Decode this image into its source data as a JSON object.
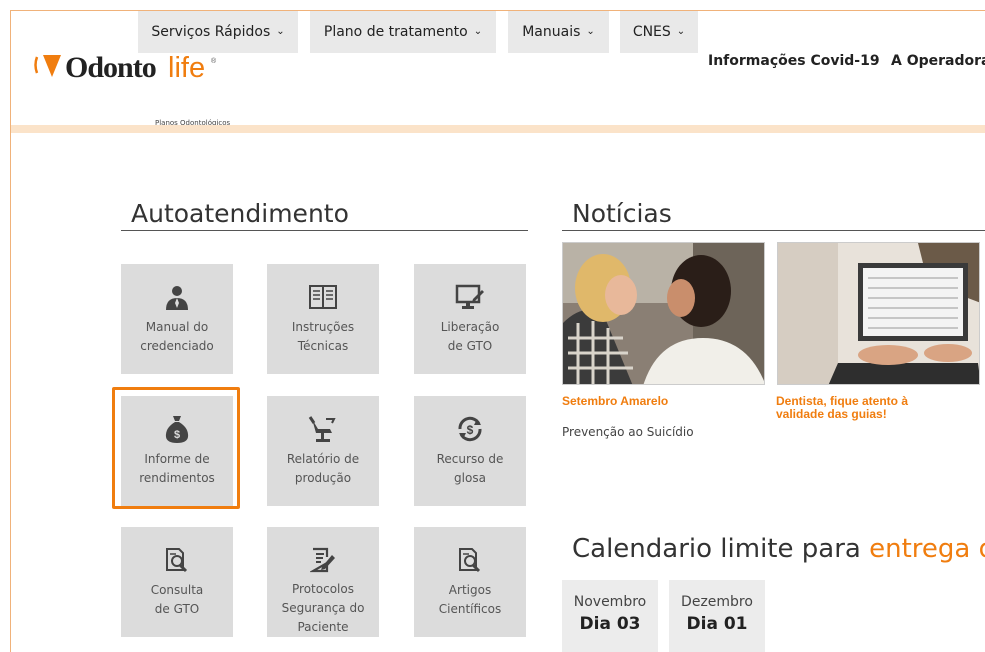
{
  "header": {
    "logo_text_1": "Odonto",
    "logo_text_2": "life",
    "logo_sub": "Planos Odontológicos",
    "nav": [
      "Informações Covid-19",
      "A Operadora"
    ]
  },
  "menu": {
    "items": [
      "Serviços Rápidos",
      "Plano de tratamento",
      "Manuais",
      "CNES"
    ],
    "chevron": "⌄"
  },
  "autoatendimento": {
    "title": "Autoatendimento",
    "tiles": [
      {
        "label": "Manual do credenciado",
        "icon": "person-tie-icon"
      },
      {
        "label": "Instruções Técnicas",
        "icon": "book-icon"
      },
      {
        "label": "Liberação de GTO",
        "icon": "monitor-pen-icon"
      },
      {
        "label": "Informe de rendimentos",
        "icon": "money-bag-icon"
      },
      {
        "label": "Relatório de produção",
        "icon": "dental-chair-icon"
      },
      {
        "label": "Recurso de glosa",
        "icon": "money-refresh-icon"
      },
      {
        "label": "Consulta de GTO",
        "icon": "document-search-icon"
      },
      {
        "label": "Protocolos Segurança do Paciente",
        "icon": "document-edit-icon"
      },
      {
        "label": "Artigos Científicos",
        "icon": "document-search-icon"
      }
    ]
  },
  "noticias": {
    "title": "Notícias",
    "items": [
      {
        "title": "Setembro Amarelo",
        "subtitle": "Prevenção ao Suicídio"
      },
      {
        "title": "Dentista, fique atento à validade das guias!",
        "subtitle": ""
      }
    ]
  },
  "calendario": {
    "title_plain": "Calendario limite para",
    "title_accent": "entrega d",
    "cards": [
      {
        "month": "Novembro",
        "day": "Dia 03"
      },
      {
        "month": "Dezembro",
        "day": "Dia 01"
      }
    ]
  },
  "colors": {
    "accent": "#f07d0f",
    "tile_bg": "#dcdcdc",
    "menu_bg": "#e9e9e9"
  }
}
